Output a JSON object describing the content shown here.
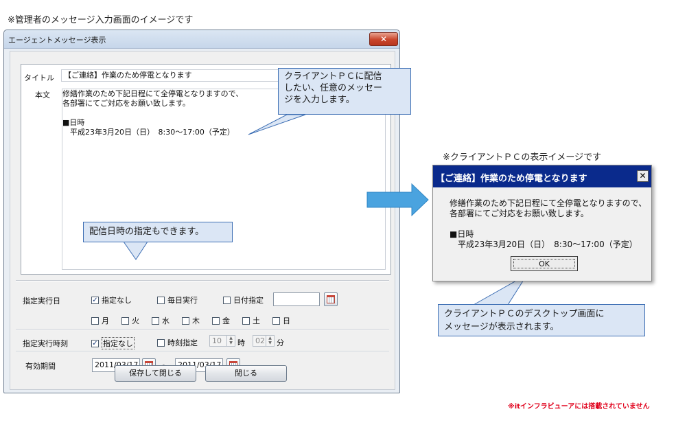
{
  "header_caption": "※管理者のメッセージ入力画面のイメージです",
  "admin_window": {
    "title": "エージェントメッセージ表示",
    "close_label": "✕",
    "title_label": "タイトル",
    "title_value": "【ご連絡】作業のため停電となります",
    "body_label": "本文",
    "body_text": "修繕作業のため下記日程にて全停電となりますので、\n各部署にてご対応をお願い致します。\n\n■日時\n　平成23年3月20日（日）　8:30～17:00（予定）",
    "exec_day_label": "指定実行日",
    "opt_none": "指定なし",
    "opt_daily": "毎日実行",
    "opt_date": "日付指定",
    "weekdays": [
      "月",
      "火",
      "水",
      "木",
      "金",
      "土",
      "日"
    ],
    "exec_time_label": "指定実行時刻",
    "opt_time_none": "指定なし",
    "opt_time": "時刻指定",
    "hour_value": "10",
    "hour_unit": "時",
    "minute_value": "02",
    "minute_unit": "分",
    "validity_label": "有効期間",
    "valid_from": "2011/03/17",
    "valid_sep": "～",
    "valid_to": "2011/03/17",
    "save_button": "保存して閉じる",
    "close_button": "閉じる"
  },
  "callouts": {
    "top": "クライアントＰＣに配信\nしたい、任意のメッセー\nジを入力します。",
    "schedule": "配信日時の指定もできます。",
    "desktop": "クライアントＰＣのデスクトップ画面に\nメッセージが表示されます。"
  },
  "client_caption": "※クライアントＰＣの表示イメージです",
  "client_popup": {
    "title": "【ご連絡】作業のため停電となります",
    "close_label": "✕",
    "body": "修繕作業のため下記日程にて全停電となりますので、\n各部署にてご対応をお願い致します。\n\n■日時\n　平成23年3月20日（日）　8:30～17:00（予定）",
    "ok_label": "OK"
  },
  "footer_note": "※itインフラビューアには搭載されていません",
  "colors": {
    "popup_title": "#0a2a8c",
    "callout_border": "#3b6db3",
    "arrow": "#4aa3df",
    "note": "#e0001b"
  }
}
